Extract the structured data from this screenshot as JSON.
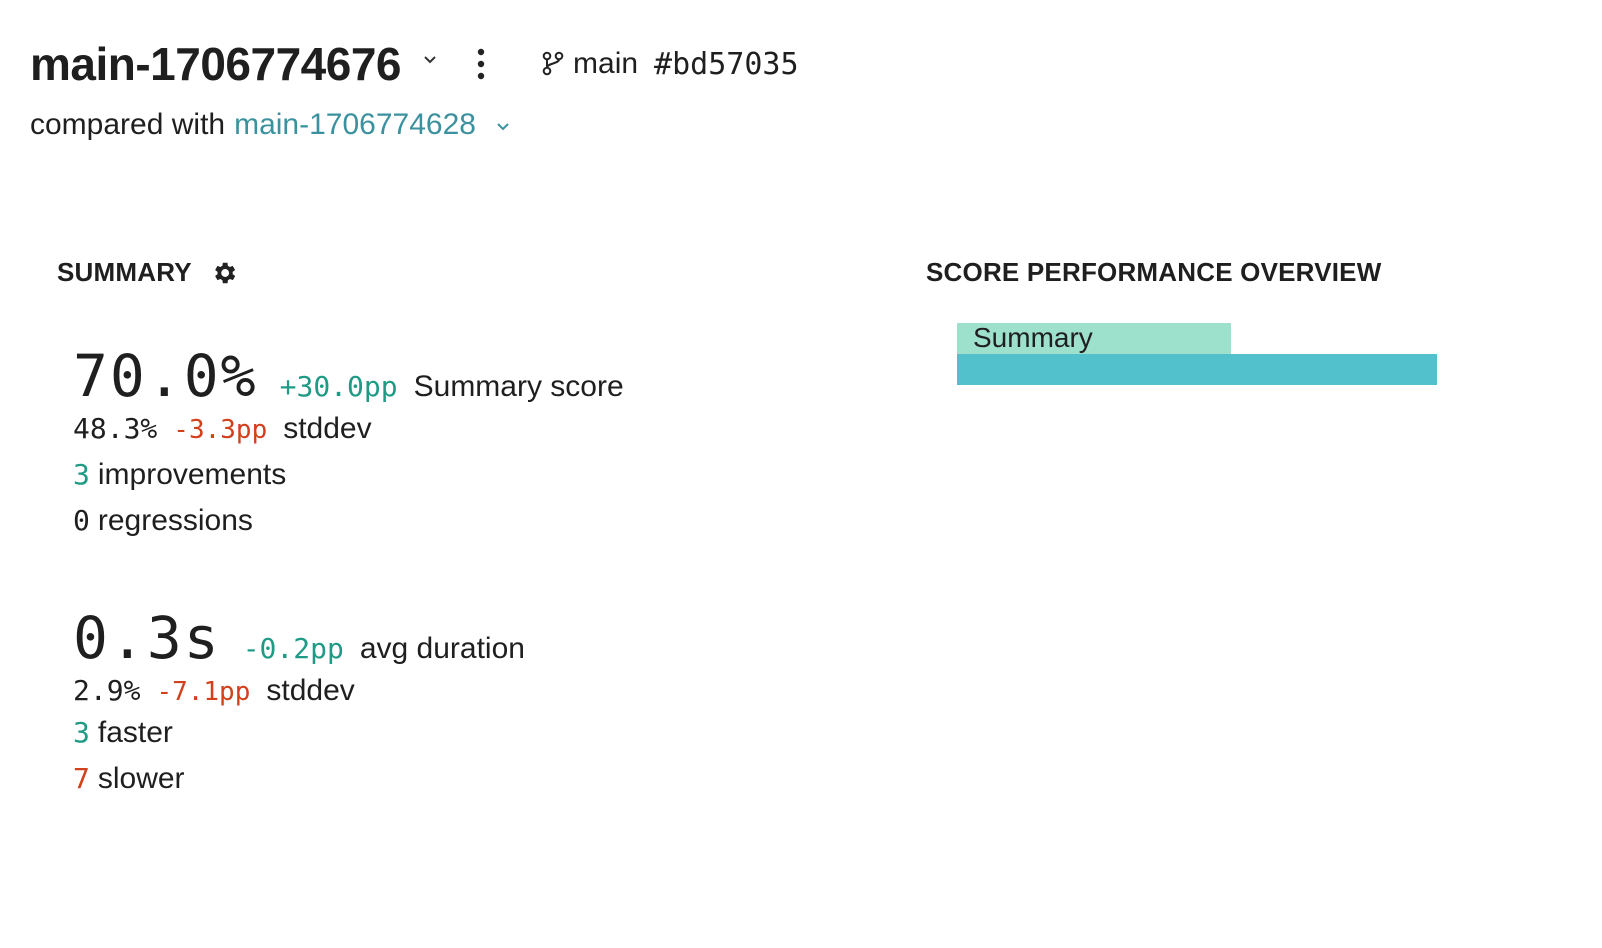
{
  "header": {
    "run_name": "main-1706774676",
    "branch": "main",
    "commit": "#bd57035",
    "compared_with_label": "compared with",
    "compared_run": "main-1706774628"
  },
  "icons": {
    "run_dropdown": "chevron-down-icon",
    "more": "kebab-icon",
    "branch": "git-branch-icon",
    "compare_dropdown": "chevron-down-icon",
    "settings": "gear-icon"
  },
  "summary": {
    "title": "SUMMARY",
    "score": {
      "value": "70.0%",
      "delta": "+30.0pp",
      "label": "Summary score",
      "stddev_value": "48.3%",
      "stddev_delta": "-3.3pp",
      "stddev_label": "stddev",
      "improvements_count": "3",
      "improvements_label": "improvements",
      "regressions_count": "0",
      "regressions_label": "regressions"
    },
    "duration": {
      "value": "0.3s",
      "delta": "-0.2pp",
      "label": "avg duration",
      "stddev_value": "2.9%",
      "stddev_delta": "-7.1pp",
      "stddev_label": "stddev",
      "faster_count": "3",
      "faster_label": "faster",
      "slower_count": "7",
      "slower_label": "slower"
    }
  },
  "colors": {
    "positive": "#1f9a85",
    "negative": "#d2401c",
    "link": "#3b929e",
    "bar_comparison": "#9de0cc",
    "bar_current": "#52c1cc"
  },
  "overview": {
    "title": "SCORE PERFORMANCE OVERVIEW"
  },
  "chart_data": {
    "type": "bar",
    "orientation": "horizontal",
    "title": "SCORE PERFORMANCE OVERVIEW",
    "categories": [
      "Summary"
    ],
    "series": [
      {
        "name": "main-1706774628",
        "values": [
          0.4
        ],
        "color": "#9de0cc"
      },
      {
        "name": "main-1706774676",
        "values": [
          0.7
        ],
        "color": "#52c1cc"
      }
    ],
    "xlim": [
      0,
      1
    ],
    "grid": false,
    "xlabel": "",
    "ylabel": ""
  }
}
